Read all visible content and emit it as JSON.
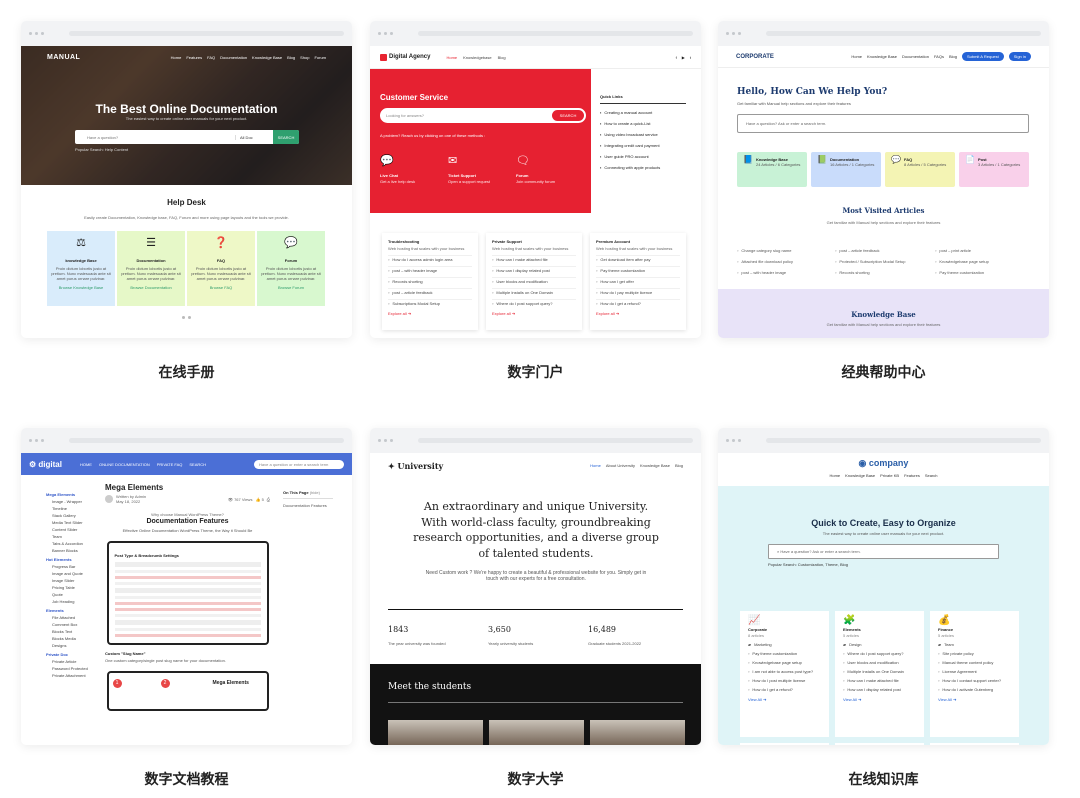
{
  "captions": [
    "在线手册",
    "数字门户",
    "经典帮助中心",
    "数字文档教程",
    "数字大学",
    "在线知识库"
  ],
  "manual": {
    "logo": "MANUAL",
    "nav": [
      "Home",
      "Features",
      "FAQ",
      "Documentation",
      "Knowledge Base",
      "Blog",
      "Shop",
      "Forum"
    ],
    "title": "The Best Online Documentation",
    "subtitle": "The easiest way to create online user manuals for your next product.",
    "search_placeholder": "Have a question?",
    "search_select": "All Doc",
    "search_button": "SEARCH",
    "popular": "Popular Search:  Help Content",
    "helpdesk": "Help Desk",
    "helpdesk_sub": "Easily create Documentation, Knowledge base, FAQ, Forum and more using page layouts and the tools we provide.",
    "boxes": [
      {
        "title": "knowledge Base",
        "desc": "Proin dictum lobortis justo at pretium. Nunc malesuada ante sit amet purus ornare pulvinar.",
        "link": "Browse Knowledge Base",
        "bg": "#d9ecfb",
        "icon": "⚖"
      },
      {
        "title": "Documentation",
        "desc": "Proin dictum lobortis justo at pretium. Nunc malesuada ante sit amet purus ornare pulvinar.",
        "link": "Browse Documentation",
        "bg": "#e6f8c8",
        "icon": "☰"
      },
      {
        "title": "FAQ",
        "desc": "Proin dictum lobortis justo at pretium. Nunc malesuada ante sit amet purus ornare pulvinar.",
        "link": "Browse FAQ",
        "bg": "#eef8c7",
        "icon": "❓"
      },
      {
        "title": "Forum",
        "desc": "Proin dictum lobortis justo at pretium. Nunc malesuada ante sit amet purus ornare pulvinar.",
        "link": "Browse Forum",
        "bg": "#d8f8cf",
        "icon": "💬"
      }
    ]
  },
  "agency": {
    "logo": "Digital Agency",
    "nav": [
      "Home",
      "Knowledgebase",
      "Blog"
    ],
    "title": "Customer Service",
    "search_placeholder": "Looking for answers?",
    "search_button": "SEARCH",
    "problem": "A problem? Reach us by clicking on one of these methods :",
    "methods": [
      {
        "icon": "💬",
        "name": "Live Chat",
        "desc": "Get a live help desk"
      },
      {
        "icon": "✉",
        "name": "Ticket Support",
        "desc": "Open a support request"
      },
      {
        "icon": "🗨",
        "name": "Forum",
        "desc": "Join community forum"
      }
    ],
    "quick_title": "Quick Links",
    "quick_links": [
      "Creating a manual account",
      "How to create a quick-List",
      "Using video broadcast service",
      "Integrating credit card payment",
      "User guide PRO account",
      "Connecting with apple products"
    ],
    "columns": [
      {
        "title": "Troubleshooting",
        "sub": "Web hosting that scales with your business",
        "items": [
          "How do I access admin login area",
          "post – with header image",
          "Records shorting",
          "post – article feedback",
          "Subscriptions Modal Setup"
        ],
        "explore": "Explore all"
      },
      {
        "title": "Private Support",
        "sub": "Web hosting that scales with your business",
        "items": [
          "How can I make attached file",
          "How can I display related post",
          "User blocks and modification",
          "Multiple Installs on One Domain",
          "Where do I post support query?"
        ],
        "explore": "Explore all"
      },
      {
        "title": "Premium Account",
        "sub": "Web hosting that scales with your business",
        "items": [
          "Get download item after pay",
          "Pay theme customization",
          "How can I get offer",
          "How do I pay multiple licence",
          "How do I get a refund?"
        ],
        "explore": "Explore all"
      }
    ]
  },
  "corporate": {
    "logo": "CORPORATE",
    "nav": [
      "Home",
      "Knowledge Base",
      "Documentation",
      "FAQs",
      "Blog"
    ],
    "btn_submit": "Submit A Request",
    "btn_signin": "Sign in",
    "title": "Hello, How Can We Help You?",
    "subtitle": "Get familiar with Manual help sections and explore their features",
    "search_placeholder": "Have a question? Ask or enter a search term.",
    "tiles": [
      {
        "name": "Knowledge Base",
        "sub": "24 Articles / 6 Categories",
        "bg": "#c8f2d6",
        "icon": "📘"
      },
      {
        "name": "Documentation",
        "sub": "16 Articles / 1 Categories",
        "bg": "#c9dcfb",
        "icon": "📗"
      },
      {
        "name": "FAQ",
        "sub": "8 Articles / 5 Categories",
        "bg": "#f4f4b4",
        "icon": "💬"
      },
      {
        "name": "Post",
        "sub": "3 Articles / 1 Categories",
        "bg": "#f9d0ea",
        "icon": "📄"
      }
    ],
    "most_title": "Most Visited Articles",
    "most_sub": "Get familiar with Manual help sections and explore their features",
    "articles": [
      "Change category slug name",
      "post – article feedback",
      "post – print article",
      "Attached file download policy",
      "Protected / Subscription Modal Setup",
      "Knowledgebase page setup",
      "post – with header image",
      "Records shorting",
      "Pay theme customization"
    ],
    "kb_title": "Knowledge Base",
    "kb_sub": "Get familiar with Manual help sections and explore their features"
  },
  "digital": {
    "logo": "digital",
    "nav": [
      "HOME",
      "ONLINE DOCUMENTATION",
      "PRIVATE FAQ",
      "SEARCH"
    ],
    "search_placeholder": "Have a question or enter a search term",
    "side": [
      {
        "h": "Mega Elements",
        "items": [
          "Image - Wrapper",
          "Timeline",
          "Stack Gallery",
          "Media Text Slider",
          "Content Slider",
          "Team",
          "Tabs & Accordion",
          "Banner Blocks"
        ]
      },
      {
        "h": "Hot Elements",
        "items": [
          "Progress Bar",
          "Image and Quote",
          "Image Slider",
          "Pricing Table",
          "Quote",
          "Job Heading"
        ]
      },
      {
        "h": "Elements",
        "items": [
          "File Attached",
          "Comment Box",
          "Blocks Text",
          "Blocks Media",
          "Designs"
        ]
      },
      {
        "h": "Private Doc",
        "items": [
          "Private Article",
          "Password Protected",
          "Private Attachment"
        ]
      }
    ],
    "title": "Mega Elements",
    "author": "Written by Admin",
    "date": "May 18, 2022",
    "views": "767 Views",
    "likes": "5",
    "why": "Why choose Manual WordPress Theme?",
    "features": "Documentation Features",
    "effective": "Effective Online Documentation WordPress Theme, the Way it Should Be",
    "shot_title": "Post Type & Breadcrumb Settings",
    "custom_slug": "Custom \"Slug Name\"",
    "custom_slug_desc": "One custom category/single post slug name for your documentation.",
    "shot2_title": "Mega Elements",
    "toc_title": "On This Page",
    "toc_tag": "(hide)",
    "toc_items": [
      "Documentation Features"
    ]
  },
  "university": {
    "logo": "University",
    "nav": [
      "Home",
      "About University",
      "Knowledge Base",
      "Blog"
    ],
    "intro": "An extraordinary and unique University. With world-class faculty, groundbreaking research opportunities, and a diverse group of talented students.",
    "need": "Need Custom work ? We're happy to create a beautiful & professional website for you. Simply get in touch with our experts for a free consultation.",
    "stats": [
      {
        "n": "1843",
        "l": "The year university was founded"
      },
      {
        "n": "3,650",
        "l": "Yearly university students"
      },
      {
        "n": "16,489",
        "l": "Graduate students 2021-2022"
      }
    ],
    "meet": "Meet the students"
  },
  "company": {
    "logo": "company",
    "nav": [
      "Home",
      "Knowledge Base",
      "Private KB",
      "Features",
      "Search"
    ],
    "title": "Quick to Create, Easy to Organize",
    "subtitle": "The easiest way to create online user manuals for your next product.",
    "search_placeholder": "Have a question? Ask or enter a search term.",
    "popular": "Popular Search:  Customization, Theme, Blog",
    "cards": [
      {
        "icon": "📈",
        "name": "Corporate",
        "count": "8 articles",
        "cat": "Marketing",
        "items": [
          "Pay theme customization",
          "Knowledgebase page setup",
          "I am not able to access post type?",
          "How do I post multiple license",
          "How do I get a refund?"
        ],
        "view": "View All"
      },
      {
        "icon": "🧩",
        "name": "Elements",
        "count": "5 articles",
        "cat": "Design",
        "items": [
          "Where do I post support query?",
          "User blocks and modification",
          "Multiple Installs on One Domain",
          "How can I make attached file",
          "How can I display related post"
        ],
        "view": "View All"
      },
      {
        "icon": "💰",
        "name": "Finance",
        "count": "5 articles",
        "cat": "Team",
        "items": [
          "Site private policy",
          "Manual theme content policy",
          "License Agreement",
          "How do I contact support center?",
          "How do I activate Gutenberg"
        ],
        "view": "View All"
      }
    ],
    "bottom_icons": [
      "💡",
      "✂",
      "✏"
    ]
  }
}
